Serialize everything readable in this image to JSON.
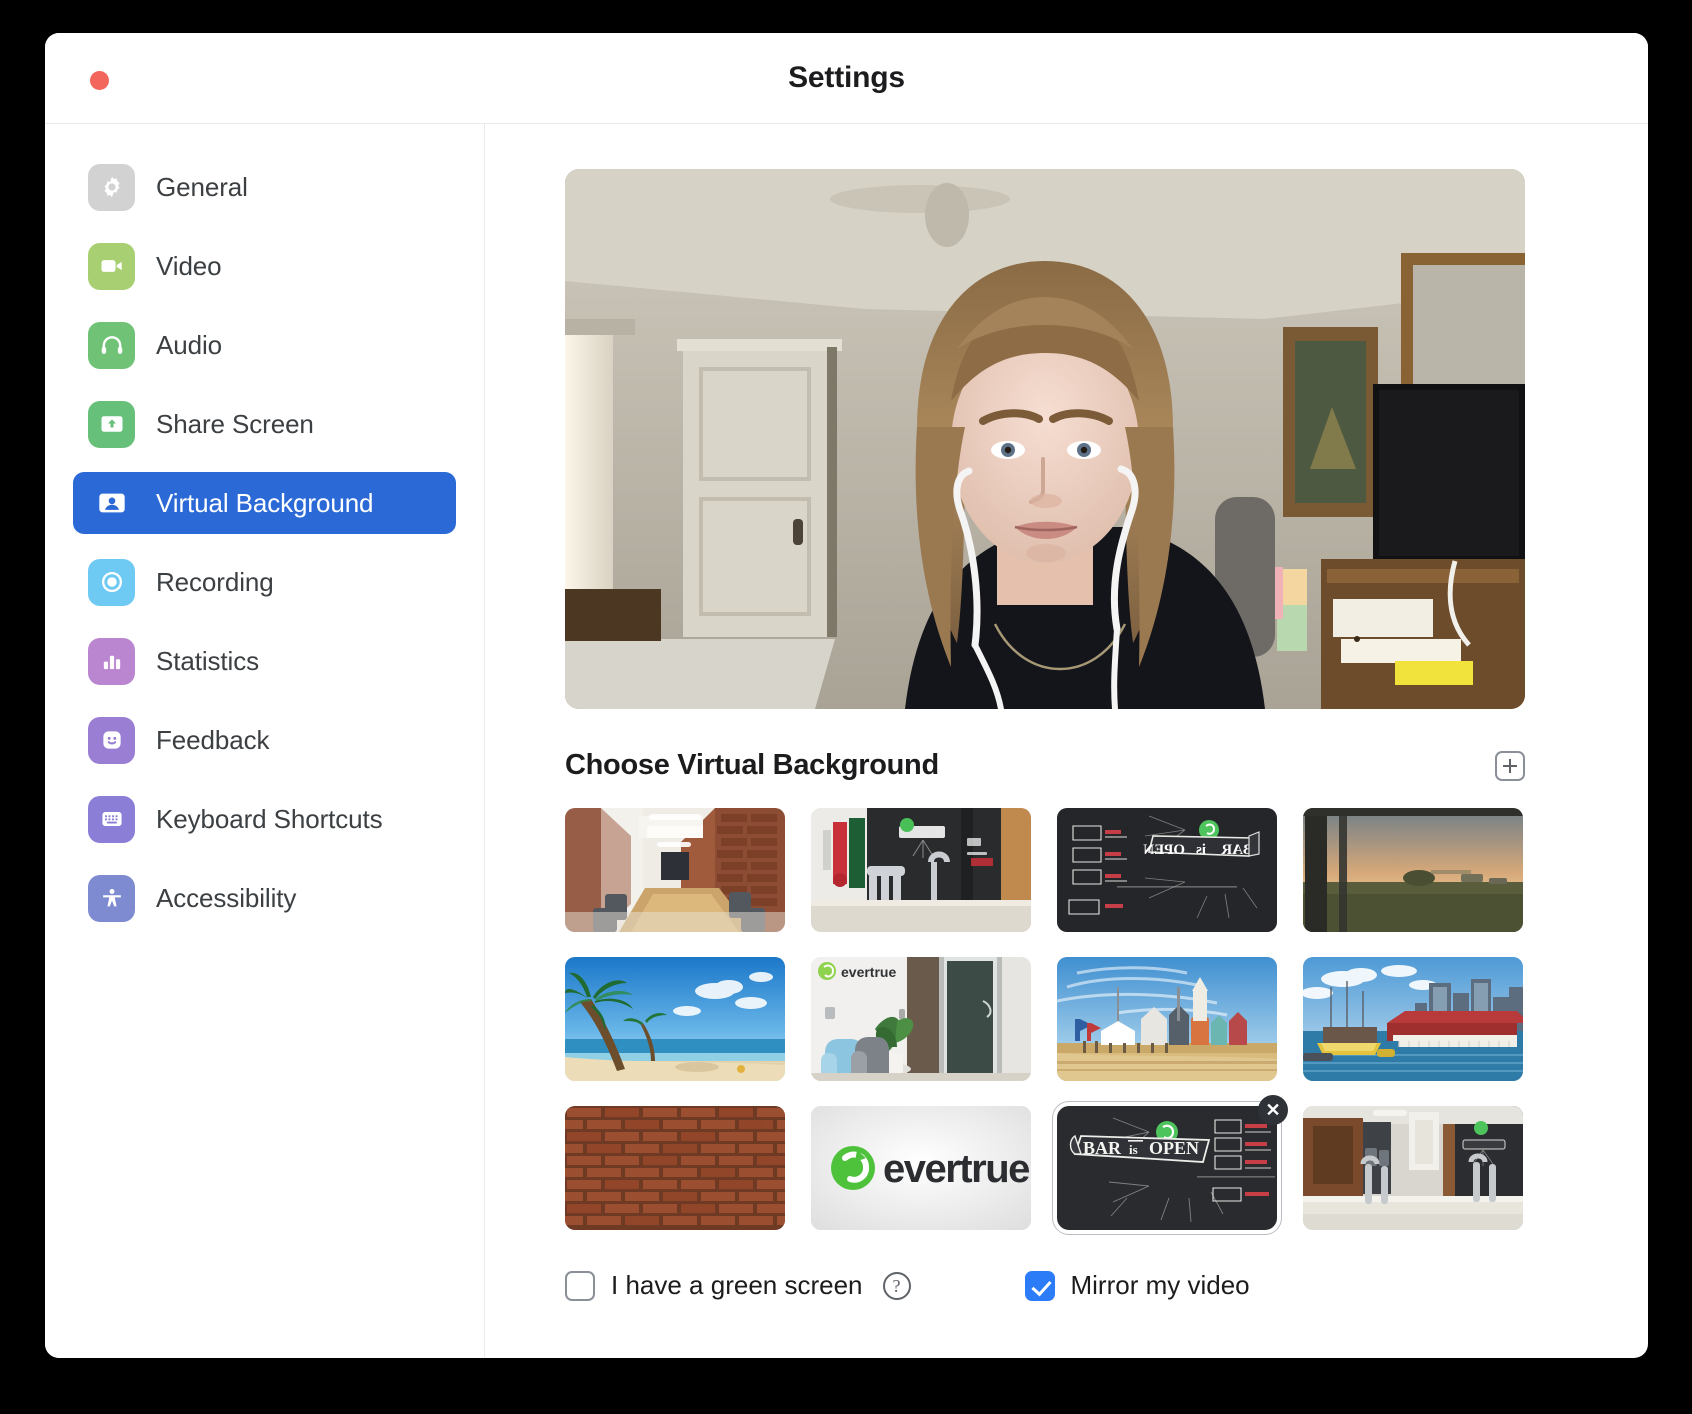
{
  "window": {
    "title": "Settings",
    "close_button_label": "close",
    "accent_color": "#2b6ad6",
    "close_color": "#f3665b"
  },
  "sidebar": {
    "items": [
      {
        "label": "General",
        "icon": "gear-icon",
        "icon_color": "#d2d2d2",
        "selected": false
      },
      {
        "label": "Video",
        "icon": "video-camera-icon",
        "icon_color": "#a8d072",
        "selected": false
      },
      {
        "label": "Audio",
        "icon": "headphones-icon",
        "icon_color": "#70c276",
        "selected": false
      },
      {
        "label": "Share Screen",
        "icon": "share-screen-icon",
        "icon_color": "#67c07a",
        "selected": false
      },
      {
        "label": "Virtual Background",
        "icon": "virtual-background-icon",
        "icon_color": "#ffffff",
        "selected": true
      },
      {
        "label": "Recording",
        "icon": "record-icon",
        "icon_color": "#6ec9f3",
        "selected": false
      },
      {
        "label": "Statistics",
        "icon": "bar-chart-icon",
        "icon_color": "#bb86d0",
        "selected": false
      },
      {
        "label": "Feedback",
        "icon": "smiley-icon",
        "icon_color": "#9a7ed4",
        "selected": false
      },
      {
        "label": "Keyboard Shortcuts",
        "icon": "keyboard-icon",
        "icon_color": "#8a7ed6",
        "selected": false
      },
      {
        "label": "Accessibility",
        "icon": "accessibility-icon",
        "icon_color": "#7e8bd0",
        "selected": false
      }
    ]
  },
  "main": {
    "video_preview": {
      "name": "camera-preview",
      "description": "Live webcam preview of a woman with curly blonde hair wearing white earbuds in a bedroom"
    },
    "background_section": {
      "title": "Choose Virtual Background",
      "add_button_label": "+",
      "thumbnails": [
        {
          "name": "office-hallway-long-table",
          "selected": false,
          "kind": "brick-office"
        },
        {
          "name": "bar-is-open-taps",
          "selected": false,
          "kind": "bar-taps"
        },
        {
          "name": "bar-is-open-chalkboard-mirrored",
          "selected": false,
          "kind": "chalk-mirror"
        },
        {
          "name": "field-at-sunset",
          "selected": false,
          "kind": "sunset-field"
        },
        {
          "name": "tropical-beach-palm",
          "selected": false,
          "kind": "beach"
        },
        {
          "name": "evertrue-office-lobby",
          "selected": false,
          "kind": "lobby"
        },
        {
          "name": "beach-boardwalk-town",
          "selected": false,
          "kind": "boardwalk"
        },
        {
          "name": "harbor-waterfront-city",
          "selected": false,
          "kind": "harbor"
        },
        {
          "name": "red-brick-wall",
          "selected": false,
          "kind": "brick"
        },
        {
          "name": "evertrue-logo",
          "selected": false,
          "kind": "logo"
        },
        {
          "name": "bar-is-open-chalkboard",
          "selected": true,
          "kind": "chalk",
          "close_label": "✕"
        },
        {
          "name": "office-kitchen-taps",
          "selected": false,
          "kind": "kitchen"
        }
      ]
    },
    "options": {
      "green_screen": {
        "label": "I have a green screen",
        "checked": false,
        "help_label": "?"
      },
      "mirror_video": {
        "label": "Mirror my video",
        "checked": true
      }
    }
  }
}
